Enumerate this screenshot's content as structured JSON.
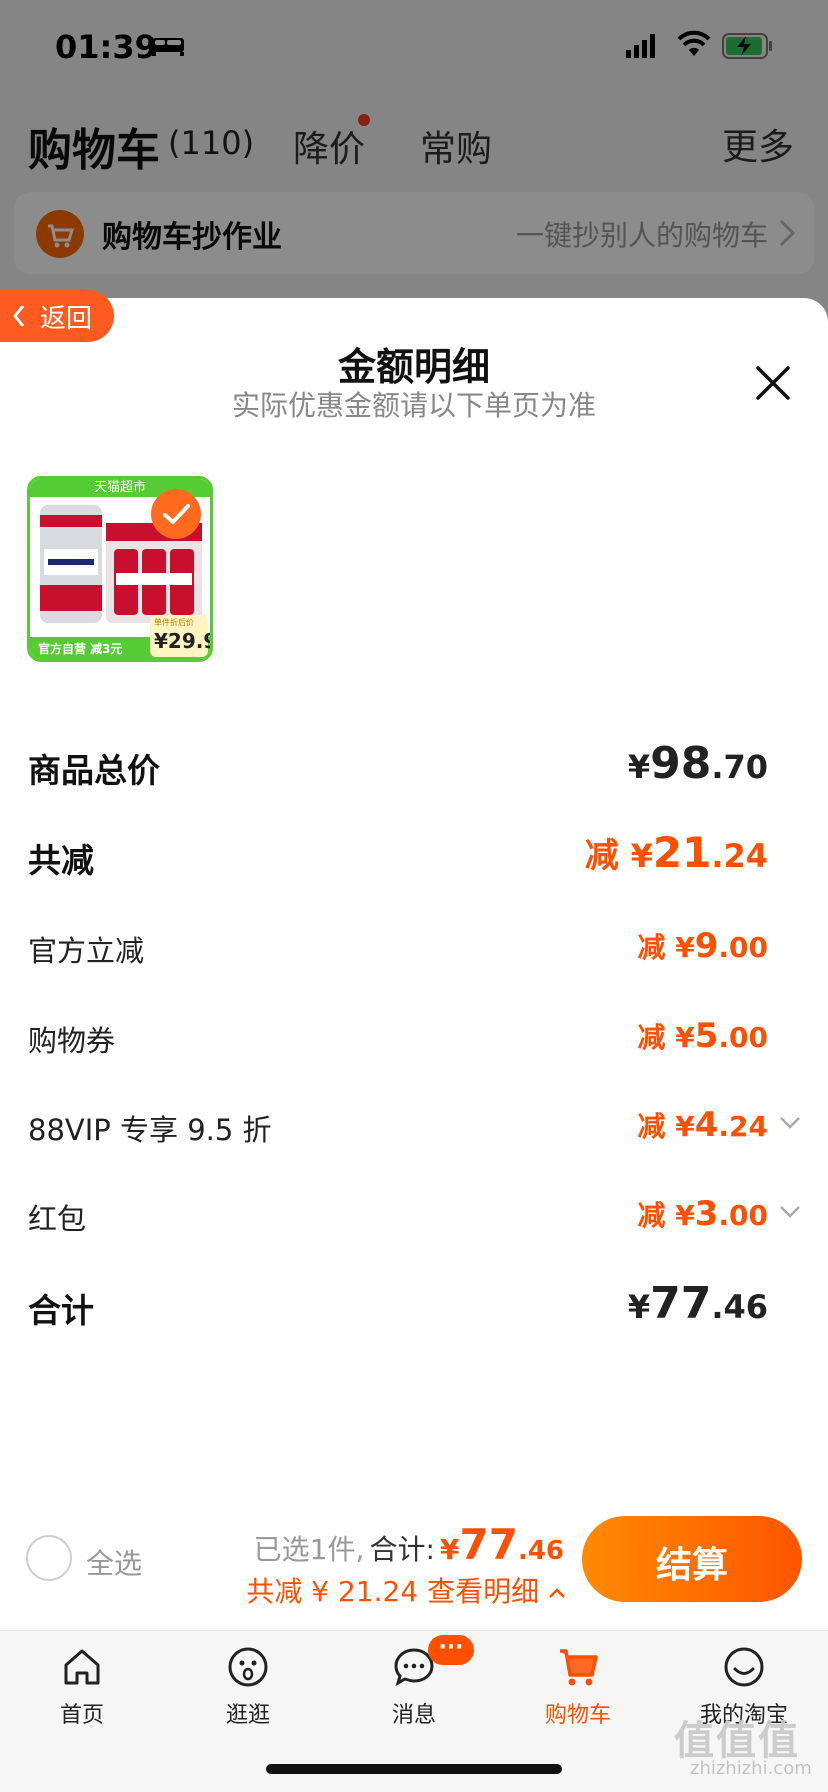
{
  "status_bar": {
    "time": "01:39"
  },
  "cart_header": {
    "title": "购物车",
    "count": "(110)",
    "tabs": [
      {
        "label": "降价"
      },
      {
        "label": "常购"
      }
    ],
    "more_label": "更多"
  },
  "homework_bar": {
    "title": "购物车抄作业",
    "subtitle": "一键抄别人的购物车"
  },
  "sheet": {
    "back_label": "返回",
    "title": "金额明细",
    "subtitle": "实际优惠金额请以下单页为准"
  },
  "product": {
    "banner": "天猫超市",
    "footer": "官方自营 减3元",
    "price_label": "单件折后价",
    "price": "¥29.9"
  },
  "breakdown": {
    "total_goods": {
      "label": "商品总价",
      "yen": "¥",
      "main": "98",
      "dec": ".70"
    },
    "total_saved": {
      "label": "共减",
      "prefix": "减 ",
      "yen": "¥",
      "main": "21",
      "dec": ".24"
    },
    "official": {
      "label": "官方立减",
      "prefix": "减 ",
      "yen": "¥",
      "main": "9",
      "dec": ".00"
    },
    "coupon": {
      "label": "购物券",
      "prefix": "减 ",
      "yen": "¥",
      "main": "5",
      "dec": ".00"
    },
    "vip": {
      "label": "88VIP 专享 9.5 折",
      "prefix": "减 ",
      "yen": "¥",
      "main": "4",
      "dec": ".24"
    },
    "redpacket": {
      "label": "红包",
      "prefix": "减 ",
      "yen": "¥",
      "main": "3",
      "dec": ".00"
    },
    "total": {
      "label": "合计",
      "yen": "¥",
      "main": "77",
      "dec": ".46"
    }
  },
  "summary": {
    "select_all": "全选",
    "selected": "已选1件,",
    "total_label": "合计:",
    "yen": "¥",
    "main": "77",
    "dec": ".46",
    "saved_text": "共减 ¥ 21.24 查看明细",
    "checkout": "结算"
  },
  "tabbar": {
    "items": [
      {
        "label": "首页"
      },
      {
        "label": "逛逛"
      },
      {
        "label": "消息"
      },
      {
        "label": "购物车"
      },
      {
        "label": "我的淘宝"
      }
    ],
    "message_badge": "···",
    "active_color": "#ff5000"
  },
  "watermark": {
    "main": "值值值",
    "sub": "zhizhizhi.com"
  },
  "colors": {
    "accent": "#ff5000",
    "tmall_green": "#55cc33"
  }
}
